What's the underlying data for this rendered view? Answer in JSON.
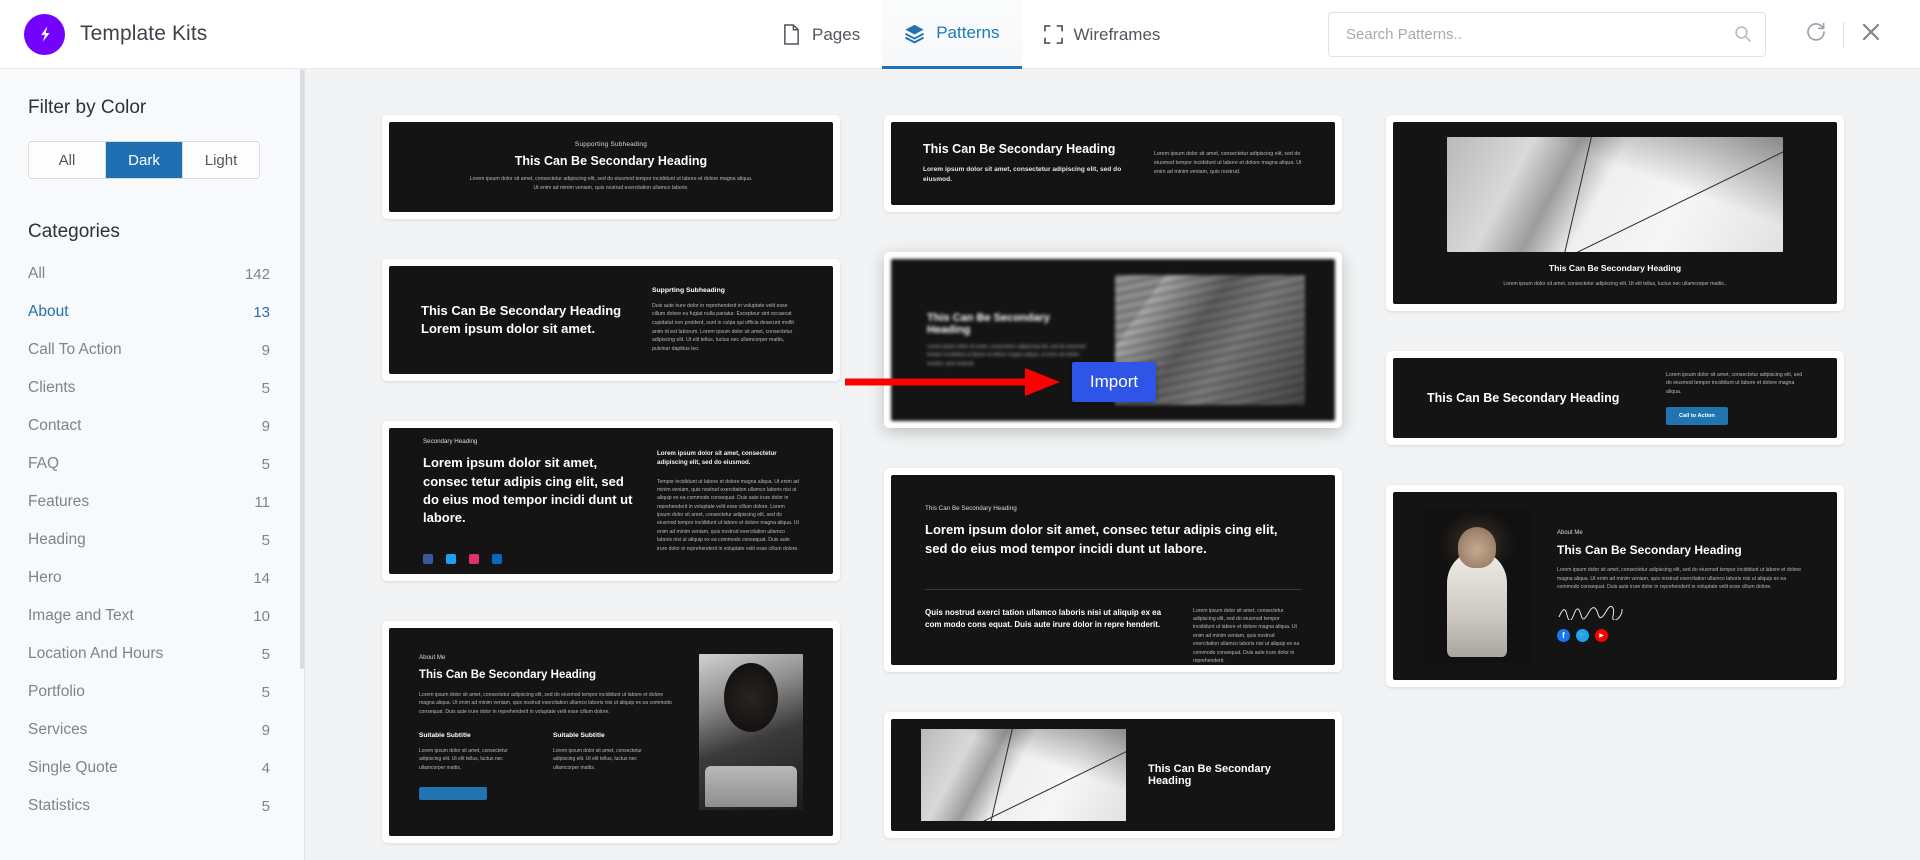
{
  "header": {
    "brand_title": "Template Kits",
    "logo_icon": "bolt-icon",
    "nav": [
      {
        "label": "Pages",
        "icon": "page-icon",
        "active": false
      },
      {
        "label": "Patterns",
        "icon": "layers-icon",
        "active": true
      },
      {
        "label": "Wireframes",
        "icon": "frame-icon",
        "active": false
      }
    ],
    "search": {
      "placeholder": "Search Patterns..",
      "value": "",
      "icon": "search-icon"
    },
    "refresh_icon": "refresh-icon",
    "close_icon": "close-icon"
  },
  "sidebar": {
    "filter_title": "Filter by Color",
    "color_filters": [
      {
        "label": "All",
        "active": false
      },
      {
        "label": "Dark",
        "active": true
      },
      {
        "label": "Light",
        "active": false
      }
    ],
    "categories_title": "Categories",
    "categories": [
      {
        "label": "All",
        "count": "142",
        "active": false
      },
      {
        "label": "About",
        "count": "13",
        "active": true
      },
      {
        "label": "Call To Action",
        "count": "9",
        "active": false
      },
      {
        "label": "Clients",
        "count": "5",
        "active": false
      },
      {
        "label": "Contact",
        "count": "9",
        "active": false
      },
      {
        "label": "FAQ",
        "count": "5",
        "active": false
      },
      {
        "label": "Features",
        "count": "11",
        "active": false
      },
      {
        "label": "Heading",
        "count": "5",
        "active": false
      },
      {
        "label": "Hero",
        "count": "14",
        "active": false
      },
      {
        "label": "Image and Text",
        "count": "10",
        "active": false
      },
      {
        "label": "Location And Hours",
        "count": "5",
        "active": false
      },
      {
        "label": "Portfolio",
        "count": "5",
        "active": false
      },
      {
        "label": "Services",
        "count": "9",
        "active": false
      },
      {
        "label": "Single Quote",
        "count": "4",
        "active": false
      },
      {
        "label": "Statistics",
        "count": "5",
        "active": false
      }
    ]
  },
  "overlay": {
    "import_label": "Import",
    "import_button_color": "#2f55e8",
    "arrow_color": "#ff0000"
  },
  "patterns": {
    "p1": {
      "subheading": "Supporting Subheading",
      "heading": "This Can Be Secondary Heading",
      "body": "Lorem ipsum dolor sit amet, consectetur adipiscing elit, sed do eiusmod tempor incididunt ut labore et dolore magna aliqua. Ut enim ad minim veniam, quis nostrud exercitation ullamco laboris."
    },
    "p2": {
      "heading": "This Can Be Secondary Heading",
      "lead": "Lorem ipsum dolor sit amet, consectetur adipiscing elit, sed do eiusmod.",
      "body": "Lorem ipsum dolor sit amet, consectetur adipiscing elit, sed do eiusmod tempor incididunt ut labore et dolore magna aliqua. Ut enim ad minim veniam, quis nostrud."
    },
    "p3": {
      "heading": "This Can Be Secondary Heading Lorem ipsum dolor sit amet.",
      "subheading": "Supprting Subheading",
      "body": "Duis aute irure dolor in reprehenderit in voluptate velit esse cillum dolore eu fugiat nulla pariatur. Excepteur sint occaecat cupidatat non proident, sunt in culpa qui officia deserunt mollit anim id est laborum. Lorem ipsum dolor sit amet, consectetur adipiscing elit. Ut elit tellus, luctus nec ullamcorper mattis, pulvinar dapibus leo."
    },
    "p4": {
      "kicker": "Secondary Heading",
      "heading": "Lorem ipsum dolor sit amet, consec tetur adipis cing elit, sed do eius mod tempor incidi dunt ut labore.",
      "lead": "Lorem ipsum dolor sit amet, consectetur adipiscing elit, sed do eiusmod.",
      "body": "Tempor incididunt ut labore et dolore magna aliqua. Ut enim ad minim veniam, quis nostrud exercitation ullamco laboris nisi ut aliquip ex ea commodo consequat. Duis aute irure dolor in reprehenderit in voluptate velit esse cillum dolore. Lorem ipsum dolor sit amet, consectetur adipiscing elit, sed do eiusmod tempor incididunt ut labore et dolore magna aliqua. Ut enim ad minim veniam, quis nostrud exercitation ullamco laboris nisi ut aliquip ex ea commodo consequat. Duis aute irure dolor in reprehenderit in voluptate velit esse cillum dolore.",
      "socials": [
        {
          "name": "facebook-icon",
          "color": "#3b5998",
          "glyph": "f"
        },
        {
          "name": "twitter-icon",
          "color": "#1da1f2",
          "glyph": "t"
        },
        {
          "name": "instagram-icon",
          "color": "#e1306c",
          "glyph": "i"
        },
        {
          "name": "linkedin-icon",
          "color": "#0a66c2",
          "glyph": "in"
        }
      ]
    },
    "p5": {
      "kicker": "This Can Be Secondary Heading",
      "heading": "Lorem ipsum dolor sit amet, consec tetur adipis cing elit, sed do eius mod tempor incidi dunt ut labore.",
      "lead": "Quis nostrud exerci tation ullamco laboris nisi ut aliquip ex ea com modo cons equat. Duis aute irure dolor in repre henderit.",
      "body": "Lorem ipsum dolor sit amet, consectetur adipiscing elit, sed do eiusmod tempor incididunt ut labore et dolore magna aliqua. Ut enim ad minim veniam, quis nostrud exercitation ullamco laboris nisi ut aliquip ex ea commodo consequat. Duis aute irure dolor in reprehenderit."
    },
    "p6": {
      "heading": "This Can Be Secondary Heading",
      "body": "Lorem ipsum dolor sit amet, consectetur adipiscing elit. Ut elit tellus, luctus nec ullamcorper mattis..",
      "image": "architecture-image"
    },
    "p7": {
      "heading": "This Can Be Secondary Heading",
      "body": "Lorem ipsum dolor sit amet, consectetur adipiscing elit, sed do eiusmod tempor incididunt ut labore et dolore magna aliqua.",
      "cta_label": "Call to Action",
      "cta_color": "#1f74b1"
    },
    "p8": {
      "kicker": "About Me",
      "heading": "This Can Be Secondary Heading",
      "body": "Lorem ipsum dolor sit amet, consectetur adipiscing elit, sed do eiusmod tempor incididunt ut labore et dolore magna aliqua. Ut enim ad minim veniam, quis nostrud exercitation ullamco laboris nisi ut aliquip ex ea commodo consequat. Duis aute irure dolor in reprehenderit in voluptate velit esse cillum dolore.",
      "signature": "signature-mark",
      "image": "portrait-image",
      "socials": [
        {
          "name": "facebook-icon",
          "color": "#1877f2",
          "glyph": "f"
        },
        {
          "name": "twitter-icon",
          "color": "#1da1f2",
          "glyph": "t"
        },
        {
          "name": "youtube-icon",
          "color": "#ff0000",
          "glyph": "▶"
        }
      ]
    },
    "p9": {
      "kicker": "About Me",
      "heading": "This Can Be Secondary Heading",
      "body": "Lorem ipsum dolor sit amet, consectetur adipiscing elit, sed do eiusmod tempor incididunt ut labore et dolore magna aliqua. Ut enim ad minim veniam, quis nostrud exercitation ullamco laboris nisi ut aliquip ex ea commodo consequat. Duis aute irure dolor in reprehenderit in voluptate velit esse cillum dolore.",
      "sub1_title": "Suitable Subtitle",
      "sub1_body": "Lorem ipsum dolor sit amet, consectetur adipiscing elit. Ut elit tellus, luctus nec ullamcorper mattis.",
      "sub2_title": "Suitable Subtitle",
      "sub2_body": "Lorem ipsum dolor sit amet, consectetur adipiscing elit. Ut elit tellus, luctus nec ullamcorper mattis.",
      "image": "woman-laptop-image"
    },
    "p10": {
      "heading": "This Can Be Secondary Heading",
      "image": "architecture-image"
    },
    "p_hover": {
      "heading": "This Can Be Secondary Heading",
      "body": "Lorem ipsum dolor sit amet, consectetur adipiscing elit, sed do eiusmod tempor incididunt ut labore et dolore magna aliqua, ut enim ad minim veniam, quis nostrud.",
      "image": "building-image"
    }
  }
}
